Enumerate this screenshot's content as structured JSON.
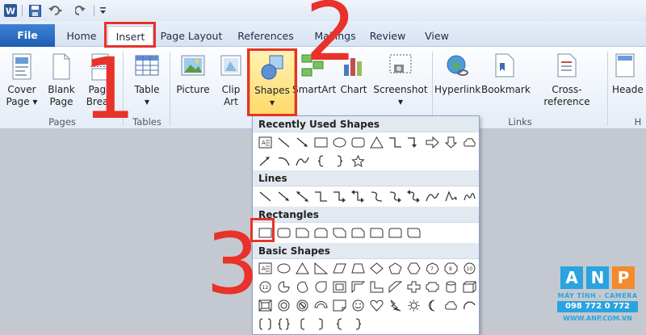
{
  "tabs": {
    "file": "File",
    "home": "Home",
    "insert": "Insert",
    "page_layout": "Page Layout",
    "references": "References",
    "mailings": "Mailings",
    "review": "Review",
    "view": "View"
  },
  "ribbon": {
    "cover_page": [
      "Cover",
      "Page ▾"
    ],
    "blank_page": [
      "Blank",
      "Page"
    ],
    "page_break": [
      "Page",
      "Break"
    ],
    "table": [
      "Table",
      "▾"
    ],
    "picture": "Picture",
    "clip_art": [
      "Clip",
      "Art"
    ],
    "shapes": [
      "Shapes",
      "▾"
    ],
    "smartart": "SmartArt",
    "chart": "Chart",
    "screenshot": [
      "Screenshot",
      "▾"
    ],
    "hyperlink": "Hyperlink",
    "bookmark": "Bookmark",
    "cross_reference": "Cross-reference",
    "header": "Heade",
    "groups": {
      "pages": "Pages",
      "tables": "Tables",
      "links": "Links",
      "header_footer": "H"
    }
  },
  "dropdown": {
    "recent": "Recently Used Shapes",
    "lines": "Lines",
    "rectangles": "Rectangles",
    "basic": "Basic Shapes"
  },
  "annotations": {
    "step1": "1",
    "step2": "2",
    "step3": "3"
  },
  "logo": {
    "letters": [
      "A",
      "N",
      "P"
    ],
    "tagline": "MÁY TÍNH - CAMERA",
    "phone": "098 772 0 772",
    "website": "WWW.ANP.COM.VN"
  },
  "colors": {
    "annotation_red": "#e8322a",
    "file_tab": "#2a6bc4",
    "logo_blue": "#2ba3de",
    "logo_orange": "#f38a2b"
  }
}
